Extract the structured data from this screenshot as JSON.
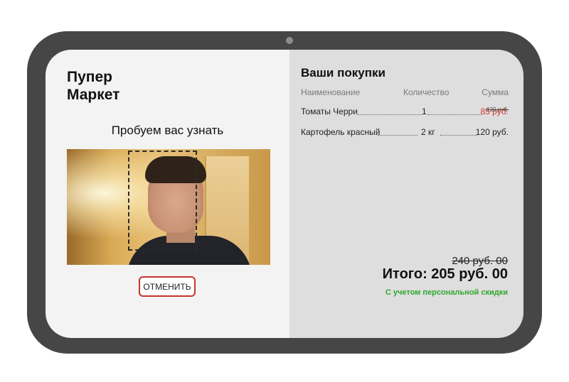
{
  "app": {
    "brand_line1": "Пупер",
    "brand_line2": "Маркет"
  },
  "recognition": {
    "status_text": "Пробуем вас узнать",
    "cancel_label": "ОТМЕНИТЬ"
  },
  "cart": {
    "title": "Ваши покупки",
    "columns": {
      "name": "Наименование",
      "quantity": "Количество",
      "sum": "Сумма"
    },
    "items": [
      {
        "name": "Томаты Черри",
        "quantity": "1",
        "old_price": "120 руб.",
        "price": "85 руб."
      },
      {
        "name": "Картофель красный",
        "quantity": "2 кг",
        "price": "120 руб."
      }
    ],
    "total_old": "240 руб. 00",
    "total": "Итого: 205 руб. 00",
    "discount_note": "С учетом персональной скидки"
  },
  "colors": {
    "device_frame": "#464646",
    "left_pane": "#f3f3f3",
    "right_pane": "#dedede",
    "discount_price": "#cf3a31",
    "discount_note": "#2ea82e",
    "cancel_border": "#c8332e"
  }
}
